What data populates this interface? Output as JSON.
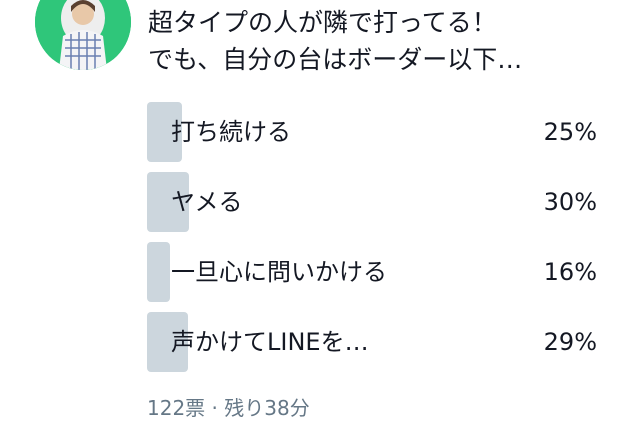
{
  "colors": {
    "avatar_bg": "#2fc67a",
    "bar_fill": "#ccd6dd",
    "meta_text": "#657786"
  },
  "tweet": {
    "avatar_icon": "user-avatar-photo",
    "question_line1": "超タイプの人が隣で打ってる！",
    "question_line2": "でも、自分の台はボーダー以下…"
  },
  "poll": {
    "options": [
      {
        "label": "打ち続ける",
        "percent_text": "25%",
        "percent": 25
      },
      {
        "label": "ヤメる",
        "percent_text": "30%",
        "percent": 30
      },
      {
        "label": "一旦心に問いかける",
        "percent_text": "16%",
        "percent": 16
      },
      {
        "label": "声かけてLINEを…",
        "percent_text": "29%",
        "percent": 29
      }
    ],
    "meta": "122票 · 残り38分"
  }
}
